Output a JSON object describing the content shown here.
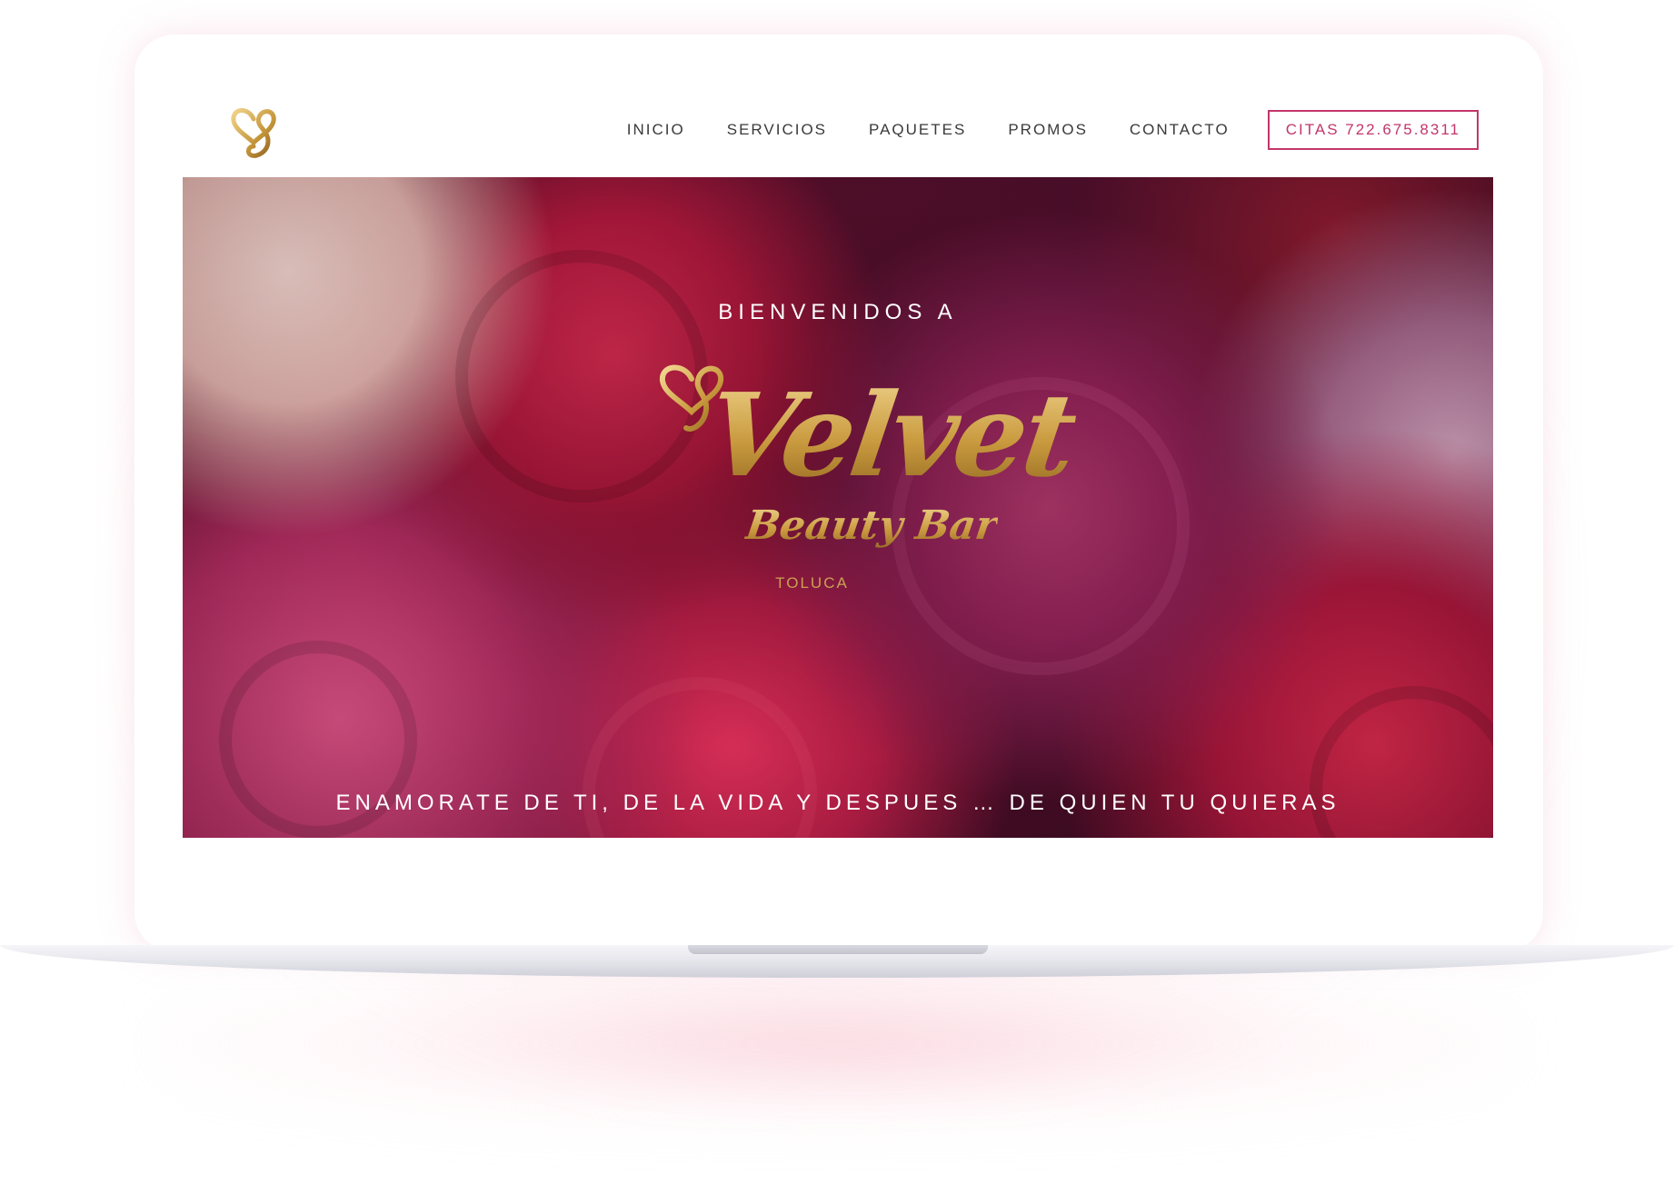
{
  "nav": {
    "items": [
      {
        "label": "INICIO"
      },
      {
        "label": "SERVICIOS"
      },
      {
        "label": "PAQUETES"
      },
      {
        "label": "PROMOS"
      },
      {
        "label": "CONTACTO"
      }
    ],
    "cta_label": "CITAS 722.675.8311"
  },
  "hero": {
    "welcome": "BIENVENIDOS A",
    "brand_name": "Velvet",
    "brand_sub": "Beauty Bar",
    "brand_city": "TOLUCA",
    "tagline": "ENAMORATE DE TI, DE LA VIDA Y DESPUES … DE QUIEN TU QUIERAS"
  },
  "colors": {
    "accent": "#c2366a",
    "gold": "#c99a3e",
    "nav_text": "#3a3a3a"
  },
  "icons": {
    "logo": "heart-swirl-icon"
  }
}
